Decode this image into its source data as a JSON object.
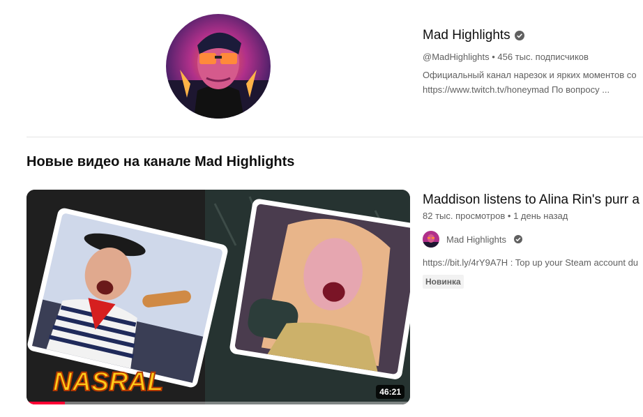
{
  "channel": {
    "avatar_icon": "channel-avatar-portrait",
    "title": "Mad Highlights",
    "verified_icon": "verified-check-icon",
    "handle": "@MadHighlights",
    "meta_sep": " • ",
    "subscribers": "456 тыс. подписчиков",
    "description_line1": "Официальный канал нарезок и ярких моментов со",
    "description_line2": "https://www.twitch.tv/honeymad По вопросу ..."
  },
  "section": {
    "title": "Новые видео на канале Mad Highlights"
  },
  "video": {
    "thumbnail_text": "NASRAL",
    "duration": "46:21",
    "watch_progress": 0.1,
    "title": "Maddison listens to Alina Rin's purr a",
    "views": "82 тыс. просмотров",
    "sep": " • ",
    "age": "1 день назад",
    "channel_name": "Mad Highlights",
    "description": "https://bit.ly/4rY9A7H : Top up your Steam account du",
    "badge": "Новинка"
  },
  "colors": {
    "progress": "#ff0033",
    "text_secondary": "#606060",
    "badge_bg": "#f2f2f2"
  }
}
